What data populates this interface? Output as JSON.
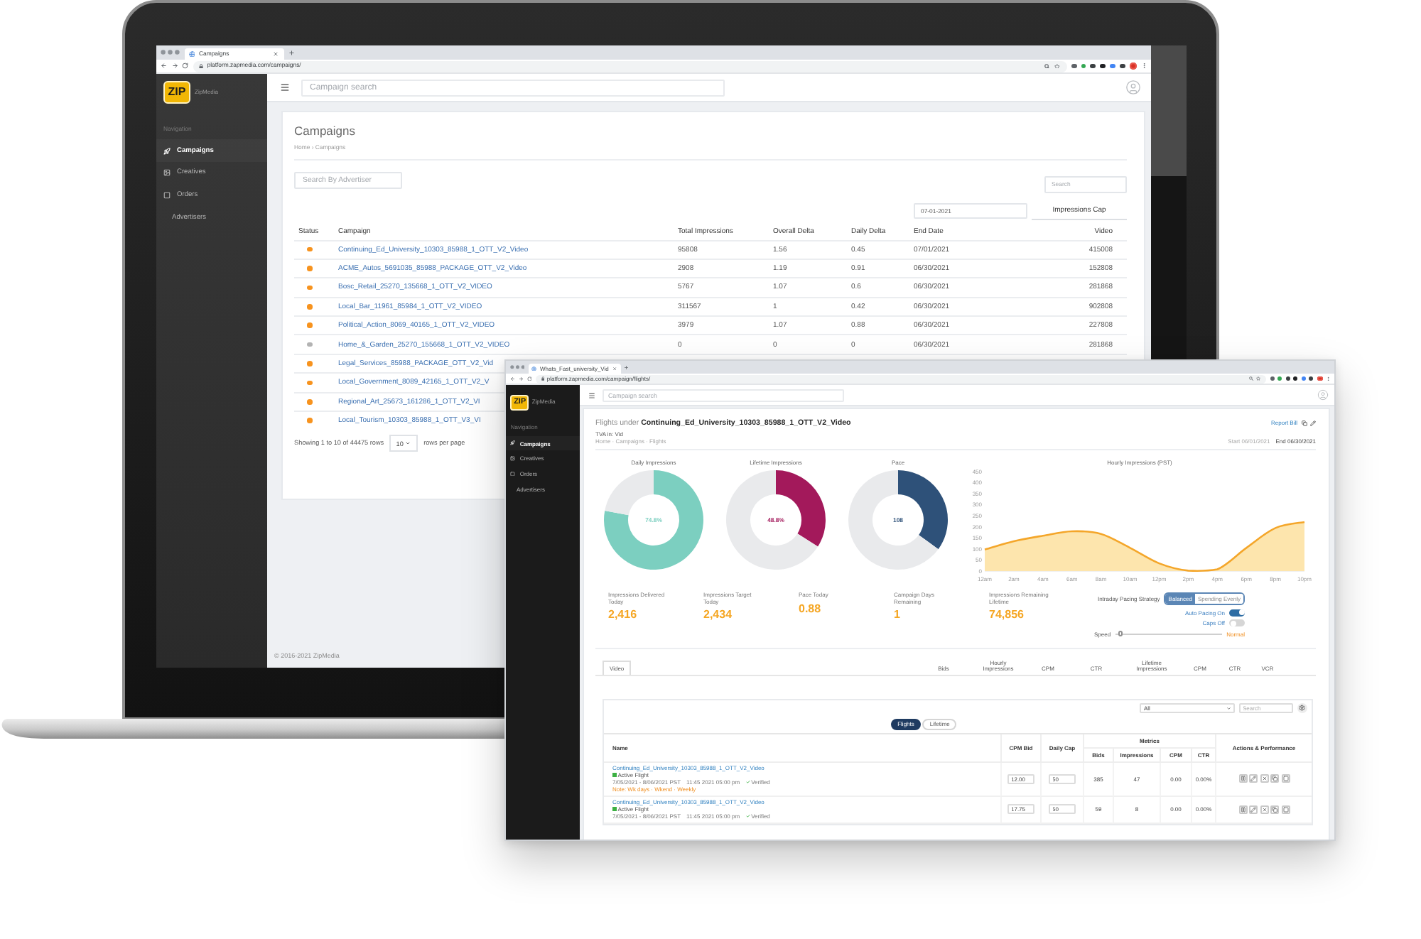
{
  "laptop_browser": {
    "tab_title": "Campaigns",
    "url": "platform.zapmedia.com/campaigns/",
    "sidebar": {
      "logo_text": "ZIP",
      "brand": "ZipMedia",
      "section_label": "Navigation",
      "items": [
        {
          "label": "Campaigns",
          "selected": true
        },
        {
          "label": "Creatives",
          "selected": false
        },
        {
          "label": "Orders",
          "selected": false
        },
        {
          "label": "Advertisers",
          "selected": false
        }
      ]
    },
    "search": {
      "placeholder": "Campaign search"
    },
    "page": {
      "title": "Campaigns",
      "breadcrumb": "Home › Campaigns",
      "advertiser_search": {
        "placeholder": "Search By Advertiser"
      },
      "table_search": {
        "placeholder": "Search"
      },
      "date_field": {
        "value": "07-01-2021"
      },
      "impressions_cap_button": "Impressions Cap",
      "table": {
        "columns": [
          "Status",
          "Campaign",
          "Total Impressions",
          "Overall Delta",
          "Daily Delta",
          "End Date",
          "Video"
        ],
        "rows": [
          {
            "color": "#f7931e",
            "cells": [
              "",
              "Continuing_Ed_University_10303_85988_1_OTT_V2_Video",
              "95808",
              "1.56",
              "0.45",
              "07/01/2021",
              "415008"
            ]
          },
          {
            "color": "#f7931e",
            "cells": [
              "",
              "ACME_Autos_5691035_85988_PACKAGE_OTT_V2_Video",
              "2908",
              "1.19",
              "0.91",
              "06/30/2021",
              "152808"
            ]
          },
          {
            "color": "#f7931e",
            "cells": [
              "",
              "Bosc_Retail_25270_135668_1_OTT_V2_VIDEO",
              "5767",
              "1.07",
              "0.6",
              "06/30/2021",
              "281868"
            ]
          },
          {
            "color": "#f7931e",
            "cells": [
              "",
              "Local_Bar_11961_85984_1_OTT_V2_VIDEO",
              "311567",
              "1",
              "0.42",
              "06/30/2021",
              "902808"
            ]
          },
          {
            "color": "#f7931e",
            "cells": [
              "",
              "Political_Action_8069_40165_1_OTT_V2_VIDEO",
              "3979",
              "1.07",
              "0.88",
              "06/30/2021",
              "227808"
            ]
          },
          {
            "color": "#b3b3b3",
            "cells": [
              "",
              "Home_&_Garden_25270_155668_1_OTT_V2_VIDEO",
              "0",
              "0",
              "0",
              "06/30/2021",
              "281868"
            ]
          },
          {
            "color": "#f7931e",
            "cells": [
              "",
              "Legal_Services_85988_PACKAGE_OTT_V2_Vid"
            ]
          },
          {
            "color": "#f7931e",
            "cells": [
              "",
              "Local_Government_8089_42165_1_OTT_V2_V"
            ]
          },
          {
            "color": "#f7931e",
            "cells": [
              "",
              "Regional_Art_25673_161286_1_OTT_V2_VI"
            ]
          },
          {
            "color": "#f7931e",
            "cells": [
              "",
              "Local_Tourism_10303_85988_1_OTT_V3_VI"
            ]
          }
        ]
      },
      "pagination": {
        "summary": "Showing 1 to 10 of 44475 rows",
        "page_size": "10",
        "suffix": "rows per page"
      }
    },
    "footer": "© 2016-2021 ZipMedia"
  },
  "flights_window": {
    "tab_title": "Whats_Fast_university_Vid",
    "url": "platform.zapmedia.com/campaign/flights/",
    "sidebar": {
      "logo_text": "ZIP",
      "brand": "ZipMedia",
      "section_label": "Navigation",
      "items": [
        {
          "label": "Campaigns",
          "selected": true
        },
        {
          "label": "Creatives",
          "selected": false
        },
        {
          "label": "Orders",
          "selected": false
        },
        {
          "label": "Advertisers",
          "selected": false
        }
      ]
    },
    "search": {
      "placeholder": "Campaign search"
    },
    "header": {
      "title": "Flights under **Continuing_Ed_University_10303_85988_1_OTT_V2_Video**",
      "subtitle": "TVA in: Vid",
      "breadcrumb": "Home · Campaigns · Flights",
      "report_link": "Report Bill",
      "meta_muted": "Start 06/01/2021",
      "meta": "End 06/30/2021"
    },
    "gauges": [
      {
        "reading": "74.8%",
        "color": "#7ccfc0",
        "chart_data": {
          "type": "donut",
          "title": "Daily Impressions",
          "values": [
            78,
            22
          ]
        }
      },
      {
        "reading": "48.8%",
        "color": "#a3195b",
        "chart_data": {
          "type": "donut",
          "title": "Lifetime Impressions",
          "values": [
            34,
            66
          ]
        }
      },
      {
        "reading": "108",
        "color": "#2e5179",
        "chart_data": {
          "type": "donut",
          "title": "Pace",
          "values": [
            35,
            65
          ]
        }
      }
    ],
    "hourly_chart": {
      "chart_data": {
        "type": "area",
        "title": "Hourly Impressions (PST)",
        "categories": [
          "12am",
          "2am",
          "4am",
          "6am",
          "8am",
          "10am",
          "12pm",
          "2pm",
          "4pm",
          "6pm",
          "8pm",
          "10pm"
        ],
        "values": [
          97,
          135,
          160,
          180,
          168,
          105,
          35,
          2,
          8,
          105,
          195,
          222
        ],
        "ylim": [
          0,
          450
        ],
        "yticks": [
          0,
          50,
          100,
          150,
          200,
          250,
          300,
          350,
          400,
          450
        ]
      }
    },
    "stats": [
      {
        "label": "Impressions Delivered Today",
        "value": "2,416"
      },
      {
        "label": "Impressions Target Today",
        "value": "2,434"
      },
      {
        "label": "Pace Today",
        "value": "0.88"
      },
      {
        "label": "Campaign Days Remaining",
        "value": "1"
      },
      {
        "label": "Impressions Remaining Lifetime",
        "value": "74,856"
      }
    ],
    "pacing": {
      "label": "Intraday Pacing Strategy",
      "options": [
        {
          "label": "Balanced",
          "selected": true
        },
        {
          "label": "Spending Evenly",
          "selected": false
        }
      ],
      "toggles": [
        {
          "label": "Auto Pacing On",
          "on": true
        },
        {
          "label": "Caps Off",
          "on": false
        }
      ],
      "speed": {
        "label": "Speed",
        "level": 0.05,
        "reading": "Normal"
      }
    },
    "summary": {
      "tabs": [
        {
          "label": "Video",
          "selected": true
        }
      ],
      "columns": [
        "Bids",
        "Hourly Impressions",
        "CPM",
        "CTR",
        "Lifetime Impressions",
        "CPM",
        "CTR",
        "VCR"
      ]
    },
    "flights": {
      "filter": {
        "value": "All"
      },
      "search": {
        "placeholder": "Search"
      },
      "view_toggle": [
        {
          "label": "Flights",
          "selected": true
        },
        {
          "label": "Lifetime",
          "selected": false
        }
      ],
      "columns": [
        "Name",
        "CPM Bid",
        "Daily Cap"
      ],
      "metrics_label": "Metrics",
      "metric_columns": [
        "Bids",
        "Impressions",
        "CPM",
        "CTR"
      ],
      "actions_label": "Actions & Performance",
      "rows": [
        {
          "name": "Continuing_Ed_University_10303_85988_1_OTT_V2_Video",
          "active": true,
          "status": "Active Flight",
          "dates": "7/05/2021 - 8/06/2021 PST",
          "time": "11:45 2021 05:00 pm",
          "verified": "Verified",
          "note": "Note: Wk days · Wkend · Weekly",
          "cpm_bid": "12.00",
          "daily_cap": "50",
          "metrics": [
            "385",
            "47",
            "0.00",
            "0.00%"
          ]
        },
        {
          "name": "Continuing_Ed_University_10303_85988_1_OTT_V2_Video",
          "active": true,
          "status": "Active Flight",
          "dates": "7/05/2021 - 8/06/2021 PST",
          "time": "11:45 2021 05:00 pm",
          "verified": "Verified",
          "cpm_bid": "17.75",
          "daily_cap": "50",
          "metrics": [
            "59",
            "8",
            "0.00",
            "0.00%"
          ]
        }
      ]
    }
  }
}
